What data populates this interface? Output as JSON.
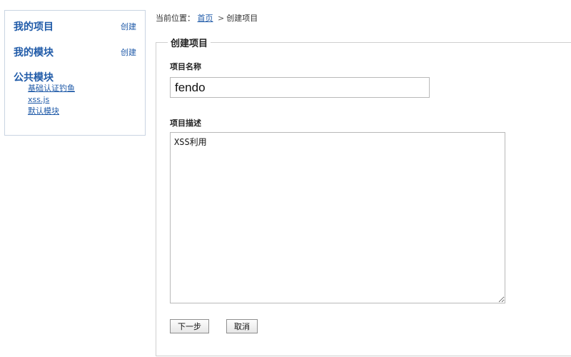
{
  "sidebar": {
    "my_projects": {
      "title": "我的项目",
      "action": "创建"
    },
    "my_modules": {
      "title": "我的模块",
      "action": "创建"
    },
    "public_modules": {
      "title": "公共模块",
      "items": [
        "基础认证钓鱼",
        "xss.js",
        "默认模块"
      ]
    }
  },
  "breadcrumb": {
    "prefix": "当前位置：",
    "home": "首页",
    "separator": ">",
    "current": "创建项目"
  },
  "form": {
    "legend": "创建项目",
    "name_label": "项目名称",
    "name_value": "fendo",
    "desc_label": "项目描述",
    "desc_value": "XSS利用",
    "next_button": "下一步",
    "cancel_button": "取消"
  }
}
